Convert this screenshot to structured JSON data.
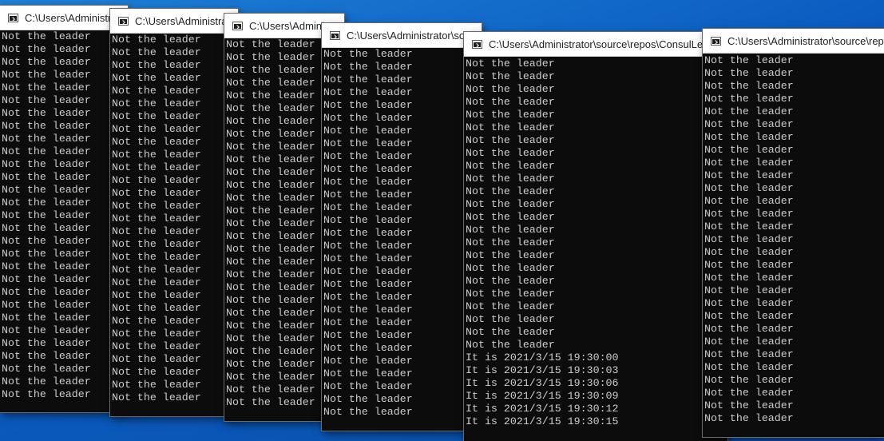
{
  "desktop": {
    "background_color": "#0a5cc0"
  },
  "windows": [
    {
      "id": "w1",
      "title": "C:\\Users\\Administrator\\source\\repos\\ConsulLeaderElection\\bin\\Debug\\ConsulLeaderElection.exe",
      "lines_text": "Not the leader",
      "line_count": 29,
      "extra_lines": []
    },
    {
      "id": "w2",
      "title": "C:\\Users\\Administrator\\source\\repos\\ConsulLeaderElection\\bin\\Debug\\ConsulLeaderElection.exe",
      "lines_text": "Not the leader",
      "line_count": 29,
      "extra_lines": []
    },
    {
      "id": "w3",
      "title": "C:\\Users\\Administrator\\source\\repos\\ConsulLeaderElection\\bin\\Debug\\ConsulLeaderElection.exe",
      "lines_text": "Not the leader",
      "line_count": 29,
      "extra_lines": []
    },
    {
      "id": "w4",
      "title": "C:\\Users\\Administrator\\source\\repos\\ConsulLeaderElection\\bin\\Debug\\ConsulLeaderElection.exe",
      "lines_text": "Not the leader",
      "line_count": 29,
      "extra_lines": []
    },
    {
      "id": "w5",
      "title": "C:\\Users\\Administrator\\source\\repos\\ConsulLeaderElection\\bin\\Debug\\ConsulLeaderElection.exe",
      "lines_text": "Not the leader",
      "line_count": 23,
      "extra_lines": [
        "It is 2021/3/15 19:30:00",
        "It is 2021/3/15 19:30:03",
        "It is 2021/3/15 19:30:06",
        "It is 2021/3/15 19:30:09",
        "It is 2021/3/15 19:30:12",
        "It is 2021/3/15 19:30:15"
      ]
    },
    {
      "id": "w6",
      "title": "C:\\Users\\Administrator\\source\\repos\\ConsulLeaderElection\\bin\\Debug\\ConsulLeaderElection.exe",
      "lines_text": "Not the leader",
      "line_count": 29,
      "extra_lines": []
    }
  ]
}
